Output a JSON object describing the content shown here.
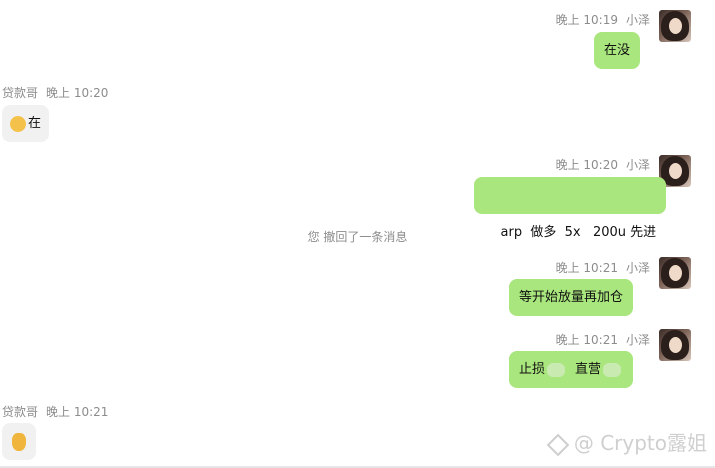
{
  "messages": [
    {
      "side": "right",
      "time": "晚上 10:19",
      "sender": "小泽",
      "text": "在没"
    },
    {
      "side": "left",
      "time": "晚上 10:20",
      "sender": "贷款哥",
      "text": "在"
    },
    {
      "side": "right",
      "time": "晚上 10:20",
      "sender": "小泽",
      "text": "arp  做多  5x   200u 先进"
    },
    {
      "side": "right",
      "time": "晚上 10:21",
      "sender": "小泽",
      "text": "等开始放量再加仓"
    },
    {
      "side": "right",
      "time": "晚上 10:21",
      "sender": "小泽",
      "text_a": "止损",
      "text_b": "直营"
    },
    {
      "side": "left",
      "time": "晚上 10:21",
      "sender": "贷款哥",
      "emoji": "ok-hand-emoji"
    }
  ],
  "system_notice": "您 撤回了一条消息",
  "watermark": "@ Crypto露姐",
  "colors": {
    "my_bubble": "#a9e67d",
    "their_bubble": "#f1f1f1",
    "meta_text": "#8c8c8c"
  }
}
